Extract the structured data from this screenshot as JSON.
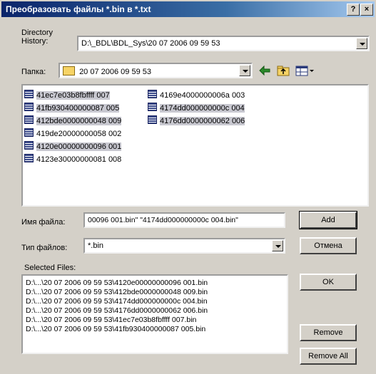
{
  "window": {
    "title": "Преобразовать файлы *.bin в *.txt",
    "help_label": "?",
    "close_label": "×"
  },
  "directory_history": {
    "label_line1": "Directory",
    "label_line2": "History:",
    "value": "D:\\_BDL\\BDL_Sys\\20 07 2006 09 59 53"
  },
  "folder": {
    "label": "Папка:",
    "value": "20 07 2006 09 59 53"
  },
  "toolbar": {
    "back_icon": "back-arrow-icon",
    "up_icon": "folder-up-icon",
    "view_icon": "view-menu-icon"
  },
  "files": [
    {
      "name": "41ec7e03b8fbffff 007",
      "selected": true
    },
    {
      "name": "41fb930400000087 005",
      "selected": true
    },
    {
      "name": "412bde0000000048 009",
      "selected": true
    },
    {
      "name": "419de20000000058 002",
      "selected": false
    },
    {
      "name": "4120e00000000096 001",
      "selected": true
    },
    {
      "name": "4123e30000000081 008",
      "selected": false
    },
    {
      "name": "4169e4000000006a 003",
      "selected": false
    },
    {
      "name": "4174dd000000000c 004",
      "selected": true
    },
    {
      "name": "4176dd0000000062 006",
      "selected": true
    }
  ],
  "filename": {
    "label": "Имя файла:",
    "value": "00096 001.bin\" \"4174dd000000000c 004.bin\""
  },
  "filetype": {
    "label": "Тип файлов:",
    "value": "*.bin"
  },
  "selected_files": {
    "label": "Selected Files:",
    "items": [
      "D:\\...\\20 07 2006 09 59 53\\4120e00000000096 001.bin",
      "D:\\...\\20 07 2006 09 59 53\\412bde0000000048 009.bin",
      "D:\\...\\20 07 2006 09 59 53\\4174dd000000000c 004.bin",
      "D:\\...\\20 07 2006 09 59 53\\4176dd0000000062 006.bin",
      "D:\\...\\20 07 2006 09 59 53\\41ec7e03b8fbffff 007.bin",
      "D:\\...\\20 07 2006 09 59 53\\41fb930400000087 005.bin"
    ]
  },
  "buttons": {
    "add": "Add",
    "cancel": "Отмена",
    "ok": "OK",
    "remove": "Remove",
    "remove_all": "Remove All"
  }
}
